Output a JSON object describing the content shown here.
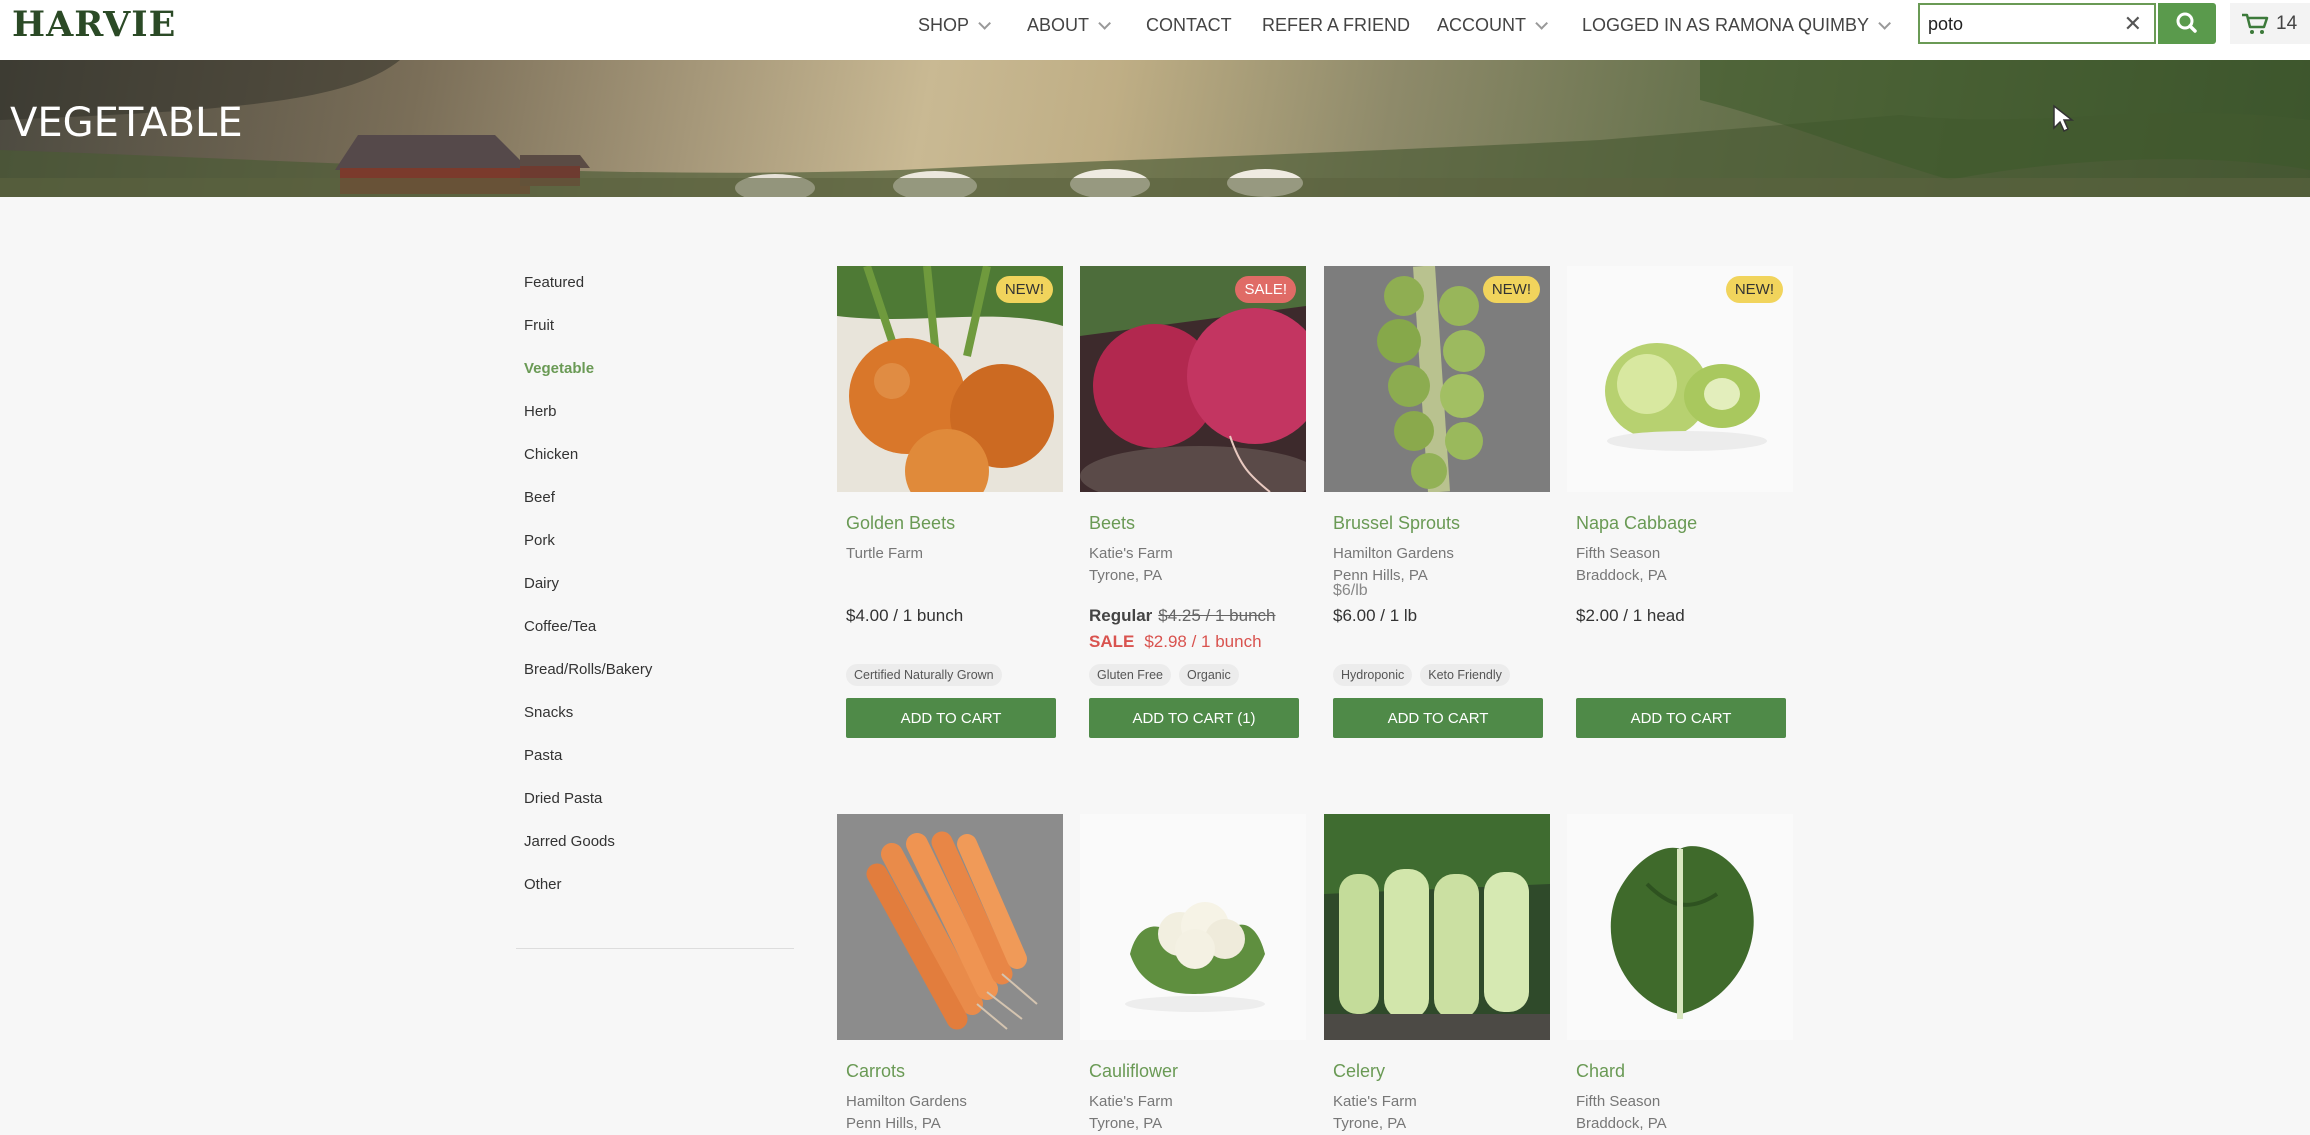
{
  "brand": "HARVIE",
  "nav": [
    {
      "label": "SHOP",
      "dropdown": true
    },
    {
      "label": "ABOUT",
      "dropdown": true
    },
    {
      "label": "CONTACT",
      "dropdown": false
    },
    {
      "label": "REFER A FRIEND",
      "dropdown": false
    },
    {
      "label": "ACCOUNT",
      "dropdown": true
    },
    {
      "label": "LOGGED IN AS RAMONA QUIMBY",
      "dropdown": true
    }
  ],
  "search": {
    "value": "poto",
    "clear_icon": "close-icon",
    "button_icon": "search-icon"
  },
  "cart": {
    "icon": "cart-icon",
    "count": "14"
  },
  "hero": {
    "title": "VEGETABLE"
  },
  "categories": [
    "Featured",
    "Fruit",
    "Vegetable",
    "Herb",
    "Chicken",
    "Beef",
    "Pork",
    "Dairy",
    "Coffee/Tea",
    "Bread/Rolls/Bakery",
    "Snacks",
    "Pasta",
    "Dried Pasta",
    "Jarred Goods",
    "Other"
  ],
  "active_category": "Vegetable",
  "products": [
    {
      "name": "Golden Beets",
      "farm": "Turtle Farm",
      "location": "",
      "badge": "NEW!",
      "price": "$4.00 / 1 bunch",
      "tags": [
        "Certified Naturally Grown"
      ],
      "button": "ADD TO CART"
    },
    {
      "name": "Beets",
      "farm": "Katie's Farm",
      "location": "Tyrone, PA",
      "badge": "SALE!",
      "regular_label": "Regular",
      "regular_price": "$4.25 / 1 bunch",
      "sale_label": "SALE",
      "sale_price": "$2.98 / 1 bunch",
      "tags": [
        "Gluten Free",
        "Organic"
      ],
      "button": "ADD TO CART (1)"
    },
    {
      "name": "Brussel Sprouts",
      "farm": "Hamilton Gardens",
      "location": "Penn Hills, PA",
      "badge": "NEW!",
      "unit_price": "$6/lb",
      "price": "$6.00 / 1 lb",
      "tags": [
        "Hydroponic",
        "Keto Friendly"
      ],
      "button": "ADD TO CART"
    },
    {
      "name": "Napa Cabbage",
      "farm": "Fifth Season",
      "location": "Braddock, PA",
      "badge": "NEW!",
      "price": "$2.00 / 1 head",
      "tags": [],
      "button": "ADD TO CART"
    },
    {
      "name": "Carrots",
      "farm": "Hamilton Gardens",
      "location": "Penn Hills, PA"
    },
    {
      "name": "Cauliflower",
      "farm": "Katie's Farm",
      "location": "Tyrone, PA"
    },
    {
      "name": "Celery",
      "farm": "Katie's Farm",
      "location": "Tyrone, PA"
    },
    {
      "name": "Chard",
      "farm": "Fifth Season",
      "location": "Braddock, PA"
    }
  ],
  "colors": {
    "brand_green": "#2b4a26",
    "accent_green": "#6a9a55",
    "button_green": "#4f8a48",
    "new_badge": "#f1d45c",
    "sale_badge": "#e06b66",
    "sale_text": "#d9534f"
  }
}
